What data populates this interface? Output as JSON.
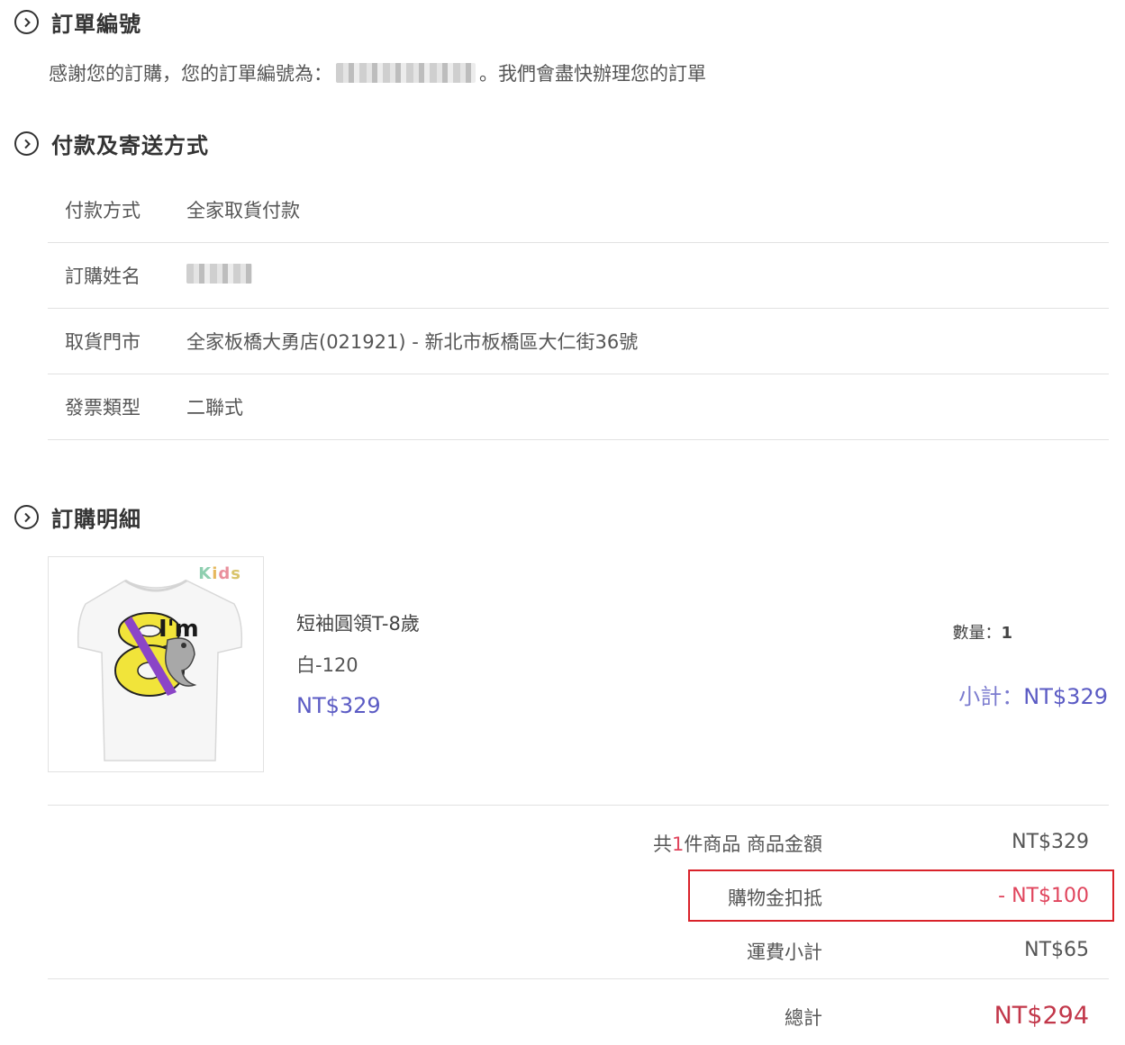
{
  "order_number": {
    "title": "訂單編號",
    "thanks_before": "感謝您的訂購，您的訂單編號為：",
    "thanks_after": "。我們會盡快辦理您的訂單"
  },
  "payment": {
    "title": "付款及寄送方式",
    "rows": [
      {
        "label": "付款方式",
        "value": "全家取貨付款"
      },
      {
        "label": "訂購姓名",
        "value": ""
      },
      {
        "label": "取貨門市",
        "value": "全家板橋大勇店(021921) - 新北市板橋區大仁街36號"
      },
      {
        "label": "發票類型",
        "value": "二聯式"
      }
    ]
  },
  "details": {
    "title": "訂購明細",
    "product": {
      "image_badge": "Kids",
      "shirt_text": "I'm",
      "name": "短袖圓領T-8歲",
      "variant": "白-120",
      "price": "NT$329",
      "quantity_label": "數量：",
      "quantity": "1",
      "subtotal_label": "小計：",
      "subtotal": "NT$329"
    }
  },
  "summary": {
    "items_prefix": "共",
    "items_count": "1",
    "items_suffix": "件商品 商品金額",
    "items_amount": "NT$329",
    "credit_label": "購物金扣抵",
    "credit_amount": "- NT$100",
    "shipping_label": "運費小計",
    "shipping_amount": "NT$65",
    "total_label": "總計",
    "total_amount": "NT$294"
  },
  "colors": {
    "accent_price": "#5b5bc4",
    "discount": "#e0455d",
    "total": "#c2374a",
    "highlight_border": "#d9222a"
  },
  "icons": [
    "chevron-circle-icon"
  ]
}
